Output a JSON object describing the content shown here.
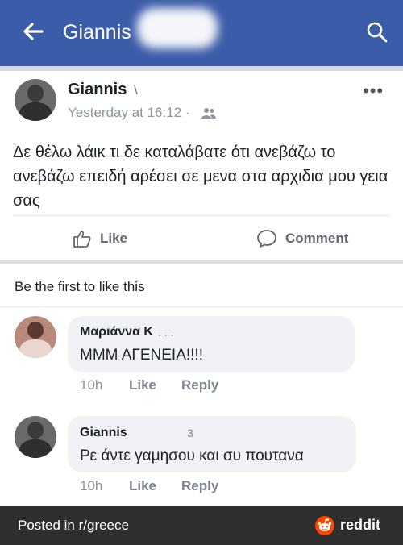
{
  "topbar": {
    "title": "Giannis",
    "color": "#3b5ca8"
  },
  "post": {
    "author": "Giannis",
    "author_mark": "\\",
    "timestamp": "Yesterday at 16:12 ·",
    "privacy_icon": "friends-icon",
    "text": "Δε θέλω λάικ τι δε καταλάβατε ότι ανεβάζω το ανεβάζω επειδή αρέσει σε μενα στα αρχιδια μου γεια σας",
    "more_label": "•••",
    "actions": {
      "like": "Like",
      "comment": "Comment"
    }
  },
  "likes_summary": "Be the first to like this",
  "comments": [
    {
      "author": "Μαριάννα Κ",
      "author_mark": ". . .",
      "text": "ΜΜΜ ΑΓΕΝΕΙΑ!!!!",
      "time": "10h",
      "like": "Like",
      "reply": "Reply"
    },
    {
      "author": "Giannis",
      "author_mark": "3",
      "text": "Ρε άντε γαμησου και συ πουτανα",
      "time": "10h",
      "like": "Like",
      "reply": "Reply"
    }
  ],
  "footer": {
    "posted_in": "Posted in r/greece",
    "brand": "reddit",
    "brand_color": "#ff4500"
  }
}
